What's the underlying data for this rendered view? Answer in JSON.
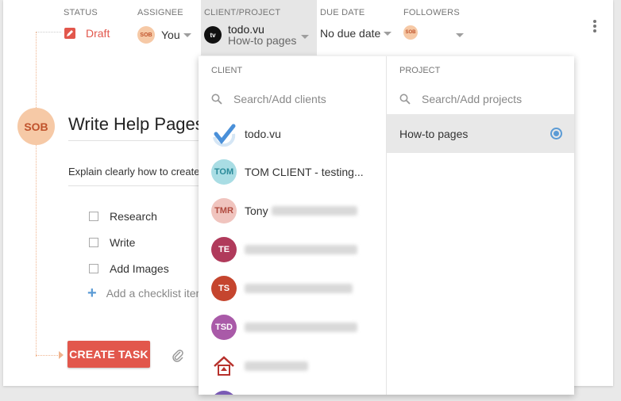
{
  "header": {
    "status": {
      "label": "STATUS",
      "value": "Draft"
    },
    "assignee": {
      "label": "ASSIGNEE",
      "avatar": "SOB",
      "value": "You"
    },
    "client_project": {
      "label": "CLIENT/PROJECT",
      "client": "todo.vu",
      "project": "How-to pages",
      "logo": "tv"
    },
    "due_date": {
      "label": "DUE DATE",
      "value": "No due date"
    },
    "followers": {
      "label": "FOLLOWERS",
      "avatar": "SOB"
    }
  },
  "task": {
    "avatar": "SOB",
    "title": "Write Help Pages",
    "description": "Explain clearly how to create",
    "checklist": [
      "Research",
      "Write",
      "Add Images"
    ],
    "add_checklist": "Add a checklist item",
    "create_button": "CREATE TASK"
  },
  "dropdown": {
    "client_header": "CLIENT",
    "client_search_placeholder": "Search/Add clients",
    "clients": [
      {
        "initials": "",
        "name": "todo.vu",
        "bg": "#ffffff",
        "fg": "#4a90d9"
      },
      {
        "initials": "TOM",
        "name": "TOM CLIENT - testing...",
        "bg": "#a9dde4",
        "fg": "#2a8a99"
      },
      {
        "initials": "TMR",
        "name": "Tony",
        "bg": "#f0c4be",
        "fg": "#b04a3e"
      },
      {
        "initials": "TE",
        "name": "",
        "bg": "#b03a5b",
        "fg": "#ffffff"
      },
      {
        "initials": "TS",
        "name": "",
        "bg": "#c5452e",
        "fg": "#ffffff"
      },
      {
        "initials": "TSD",
        "name": "",
        "bg": "#a95aa8",
        "fg": "#ffffff"
      }
    ],
    "project_header": "PROJECT",
    "project_search_placeholder": "Search/Add projects",
    "projects": [
      {
        "name": "How-to pages",
        "selected": true
      }
    ]
  },
  "colors": {
    "accent_red": "#e2574c",
    "accent_blue": "#5b9bd5",
    "avatar_peach": "#f6c9a6"
  }
}
